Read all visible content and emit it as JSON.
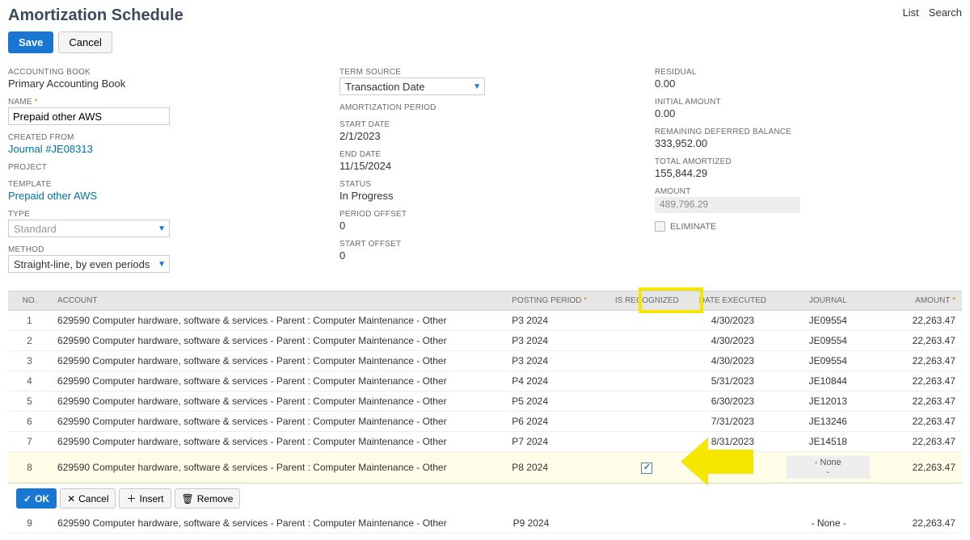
{
  "header": {
    "title": "Amortization Schedule",
    "links": {
      "list": "List",
      "search": "Search"
    },
    "save": "Save",
    "cancel": "Cancel"
  },
  "col1": {
    "accountingBook": {
      "label": "ACCOUNTING BOOK",
      "value": "Primary Accounting Book"
    },
    "name": {
      "label": "NAME",
      "value": "Prepaid other AWS"
    },
    "createdFrom": {
      "label": "CREATED FROM",
      "value": "Journal #JE08313"
    },
    "project": {
      "label": "PROJECT",
      "value": ""
    },
    "template": {
      "label": "TEMPLATE",
      "value": "Prepaid other AWS"
    },
    "type": {
      "label": "TYPE",
      "value": "Standard"
    },
    "method": {
      "label": "METHOD",
      "value": "Straight-line, by even periods"
    }
  },
  "col2": {
    "termSource": {
      "label": "TERM SOURCE",
      "value": "Transaction Date"
    },
    "amortPeriod": {
      "label": "AMORTIZATION PERIOD",
      "value": ""
    },
    "startDate": {
      "label": "START DATE",
      "value": "2/1/2023"
    },
    "endDate": {
      "label": "END DATE",
      "value": "11/15/2024"
    },
    "status": {
      "label": "STATUS",
      "value": "In Progress"
    },
    "periodOffset": {
      "label": "PERIOD OFFSET",
      "value": "0"
    },
    "startOffset": {
      "label": "START OFFSET",
      "value": "0"
    }
  },
  "col3": {
    "residual": {
      "label": "RESIDUAL",
      "value": "0.00"
    },
    "initialAmount": {
      "label": "INITIAL AMOUNT",
      "value": "0.00"
    },
    "remaining": {
      "label": "REMAINING DEFERRED BALANCE",
      "value": "333,952.00"
    },
    "totalAmortized": {
      "label": "TOTAL AMORTIZED",
      "value": "155,844.29"
    },
    "amount": {
      "label": "AMOUNT",
      "value": "489,796.29"
    },
    "eliminate": {
      "label": "ELIMINATE"
    }
  },
  "table": {
    "headers": {
      "no": "NO.",
      "account": "ACCOUNT",
      "postingPeriod": "POSTING PERIOD",
      "isRecognized": "IS RECOGNIZED",
      "dateExecuted": "DATE EXECUTED",
      "journal": "JOURNAL",
      "amount": "AMOUNT"
    },
    "accountText": "629590 Computer hardware, software & services - Parent : Computer Maintenance - Other",
    "none": "- None -",
    "rows": [
      {
        "no": "1",
        "period": "P3 2024",
        "date": "4/30/2023",
        "journal": "JE09554",
        "amount": "22,263.47"
      },
      {
        "no": "2",
        "period": "P3 2024",
        "date": "4/30/2023",
        "journal": "JE09554",
        "amount": "22,263.47"
      },
      {
        "no": "3",
        "period": "P3 2024",
        "date": "4/30/2023",
        "journal": "JE09554",
        "amount": "22,263.47"
      },
      {
        "no": "4",
        "period": "P4 2024",
        "date": "5/31/2023",
        "journal": "JE10844",
        "amount": "22,263.47"
      },
      {
        "no": "5",
        "period": "P5 2024",
        "date": "6/30/2023",
        "journal": "JE12013",
        "amount": "22,263.47"
      },
      {
        "no": "6",
        "period": "P6 2024",
        "date": "7/31/2023",
        "journal": "JE13246",
        "amount": "22,263.47"
      },
      {
        "no": "7",
        "period": "P7 2024",
        "date": "8/31/2023",
        "journal": "JE14518",
        "amount": "22,263.47"
      }
    ],
    "editRow": {
      "no": "8",
      "period": "P8 2024",
      "amount": "22,263.47"
    },
    "afterRow": {
      "no": "9",
      "period": "P9 2024",
      "amount": "22,263.47"
    }
  },
  "rowActions": {
    "ok": "OK",
    "cancel": "Cancel",
    "insert": "Insert",
    "remove": "Remove"
  }
}
